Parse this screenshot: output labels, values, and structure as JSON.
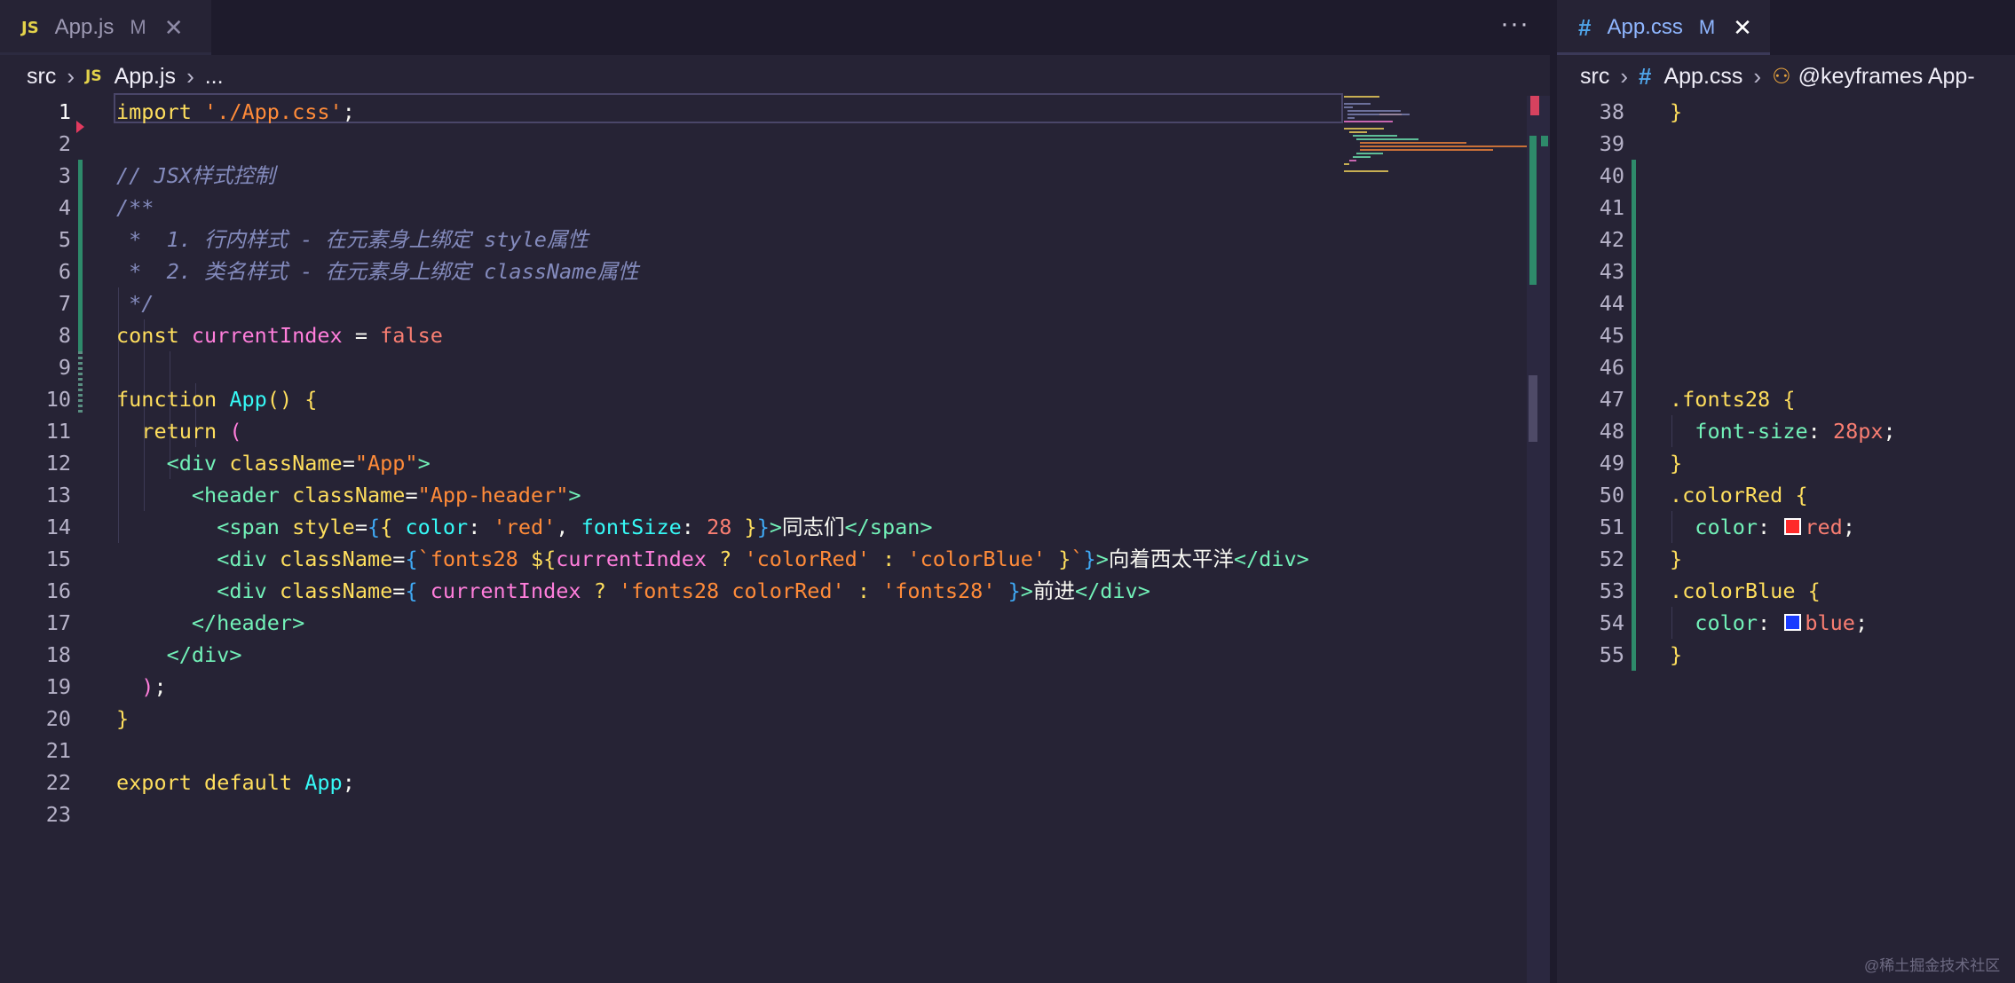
{
  "left_tab": {
    "icon": "JS",
    "label": "App.js",
    "modified": "M"
  },
  "right_tab": {
    "icon": "#",
    "label": "App.css",
    "modified": "M"
  },
  "more_actions": "···",
  "left_breadcrumb": {
    "folder": "src",
    "file_icon": "JS",
    "file": "App.js",
    "tail": "..."
  },
  "right_breadcrumb": {
    "folder": "src",
    "file_icon": "#",
    "file": "App.css",
    "symbol_icon": "keyframes-icon",
    "symbol": "@keyframes App-"
  },
  "left_line_numbers": [
    "1",
    "2",
    "3",
    "4",
    "5",
    "6",
    "7",
    "8",
    "9",
    "10",
    "11",
    "12",
    "13",
    "14",
    "15",
    "16",
    "17",
    "18",
    "19",
    "20",
    "21",
    "22",
    "23"
  ],
  "left_code": {
    "l1": {
      "kw": "import",
      "str": "'./App.css'",
      "end": ";"
    },
    "l3": "// JSX样式控制",
    "l4": "/**",
    "l5": " *  1. 行内样式 - 在元素身上绑定 style属性",
    "l6": " *  2. 类名样式 - 在元素身上绑定 className属性",
    "l7": " */",
    "l8": {
      "kw": "const",
      "var": "currentIndex",
      "op": "=",
      "val": "false"
    },
    "l10": {
      "kw": "function",
      "fn": "App",
      "paren": "()",
      "brace": "{"
    },
    "l11": {
      "kw": "return",
      "paren": "("
    },
    "l12": {
      "open": "<div",
      "attr": "className",
      "eq": "=",
      "str": "\"App\"",
      "close": ">"
    },
    "l13": {
      "open": "<header",
      "attr": "className",
      "eq": "=",
      "str": "\"App-header\"",
      "close": ">"
    },
    "l14": {
      "open": "<span",
      "attr": "style",
      "eq": "=",
      "b1": "{",
      "b2": "{",
      "k1": "color",
      "c1": ":",
      "v1": "'red'",
      "comma": ",",
      "k2": "fontSize",
      "c2": ":",
      "v2": "28",
      "b3": "}",
      "b4": "}",
      "close": ">",
      "text": "同志们",
      "end": "</span>"
    },
    "l15": {
      "open": "<div",
      "attr": "className",
      "eq": "=",
      "b1": "{",
      "tpl1": "`fonts28 ",
      "interp": "${",
      "var": "currentIndex",
      "q": "?",
      "s1": "'colorRed'",
      "colon": ":",
      "s2": "'colorBlue'",
      "ib": "}",
      "tpl2": "`",
      "b2": "}",
      "close": ">",
      "text": "向着西太平洋",
      "end": "</div>"
    },
    "l16": {
      "open": "<div",
      "attr": "className",
      "eq": "=",
      "b1": "{",
      "var": "currentIndex",
      "q": "?",
      "s1": "'fonts28 colorRed'",
      "colon": ":",
      "s2": "'fonts28'",
      "b2": "}",
      "close": ">",
      "text": "前进",
      "end": "</div>"
    },
    "l17": "</header>",
    "l18": "</div>",
    "l19": {
      "paren": ")",
      "semi": ";"
    },
    "l20": "}",
    "l22": {
      "kw1": "export",
      "kw2": "default",
      "fn": "App",
      "semi": ";"
    }
  },
  "right_line_numbers": [
    "38",
    "39",
    "40",
    "41",
    "42",
    "43",
    "44",
    "45",
    "46",
    "47",
    "48",
    "49",
    "50",
    "51",
    "52",
    "53",
    "54",
    "55"
  ],
  "right_code": {
    "l38": "}",
    "l47": {
      "sel": ".fonts28",
      "brace": "{"
    },
    "l48": {
      "prop": "font-size",
      "colon": ":",
      "val": "28px",
      "semi": ";"
    },
    "l49": "}",
    "l50": {
      "sel": ".colorRed",
      "brace": "{"
    },
    "l51": {
      "prop": "color",
      "colon": ":",
      "swatch": "#ff2a2a",
      "val": "red",
      "semi": ";"
    },
    "l52": "}",
    "l53": {
      "sel": ".colorBlue",
      "brace": "{"
    },
    "l54": {
      "prop": "color",
      "colon": ":",
      "swatch": "#1a3cff",
      "val": "blue",
      "semi": ";"
    },
    "l55": "}"
  },
  "watermark": "@稀土掘金技术社区"
}
